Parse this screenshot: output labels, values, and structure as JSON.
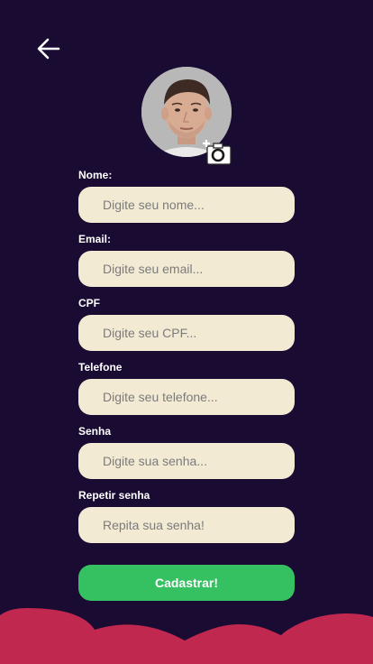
{
  "nav": {
    "back_icon": "arrow-left-icon"
  },
  "profile": {
    "avatar_alt": "",
    "camera_icon": "camera-add-icon"
  },
  "form": {
    "name_label": "Nome:",
    "name_placeholder": "Digite seu nome...",
    "email_label": "Email:",
    "email_placeholder": "Digite seu email...",
    "cpf_label": "CPF",
    "cpf_placeholder": "Digite seu CPF...",
    "phone_label": "Telefone",
    "phone_placeholder": "Digite seu telefone...",
    "password_label": "Senha",
    "password_placeholder": "Digite sua senha...",
    "repeat_label": "Repetir senha",
    "repeat_placeholder": "Repita sua senha!"
  },
  "actions": {
    "submit_label": "Cadastrar!"
  },
  "colors": {
    "background": "#1a0b33",
    "input_bg": "#f3ead4",
    "button_bg": "#35c062",
    "wave": "#c0284f"
  }
}
